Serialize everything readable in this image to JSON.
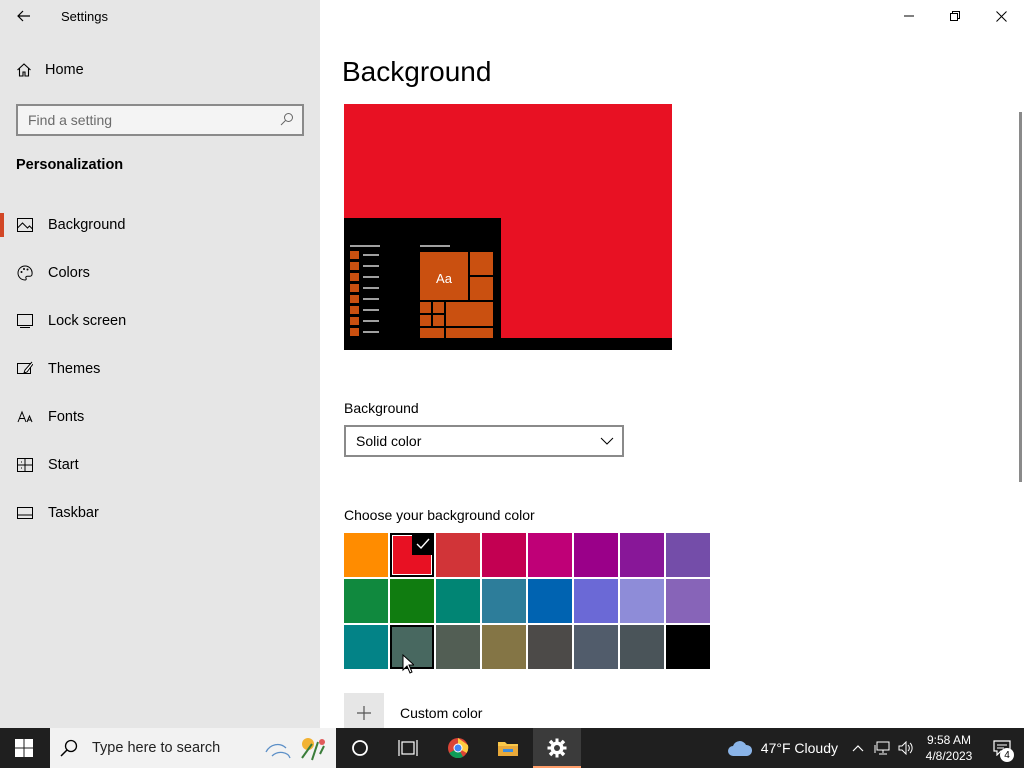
{
  "window": {
    "title": "Settings"
  },
  "sidebar": {
    "home_label": "Home",
    "search_placeholder": "Find a setting",
    "section": "Personalization",
    "items": [
      {
        "label": "Background",
        "icon": "picture-icon",
        "active": true
      },
      {
        "label": "Colors",
        "icon": "palette-icon"
      },
      {
        "label": "Lock screen",
        "icon": "lock-screen-icon"
      },
      {
        "label": "Themes",
        "icon": "brush-icon"
      },
      {
        "label": "Fonts",
        "icon": "fonts-icon"
      },
      {
        "label": "Start",
        "icon": "start-icon"
      },
      {
        "label": "Taskbar",
        "icon": "taskbar-icon"
      }
    ]
  },
  "main": {
    "title": "Background",
    "preview": {
      "color": "#e81123",
      "tile_text": "Aa",
      "accent": "#ca5010"
    },
    "background_label": "Background",
    "background_value": "Solid color",
    "choose_label": "Choose your background color",
    "colors": [
      "#ff8c00",
      "#e81123",
      "#d13438",
      "#c30052",
      "#bf0077",
      "#9a0089",
      "#881798",
      "#744da9",
      "#10893e",
      "#107c10",
      "#018574",
      "#2d7d9a",
      "#0063b1",
      "#6b69d6",
      "#8e8cd8",
      "#8764b8",
      "#038387",
      "#486860",
      "#525e54",
      "#847545",
      "#4c4a48",
      "#515c6b",
      "#4a5459",
      "#000000"
    ],
    "selected_color": "#e81123",
    "custom_label": "Custom color"
  },
  "taskbar": {
    "search_placeholder": "Type here to search",
    "weather": "47°F  Cloudy",
    "time": "9:58 AM",
    "date": "4/8/2023",
    "notifications": "4"
  }
}
